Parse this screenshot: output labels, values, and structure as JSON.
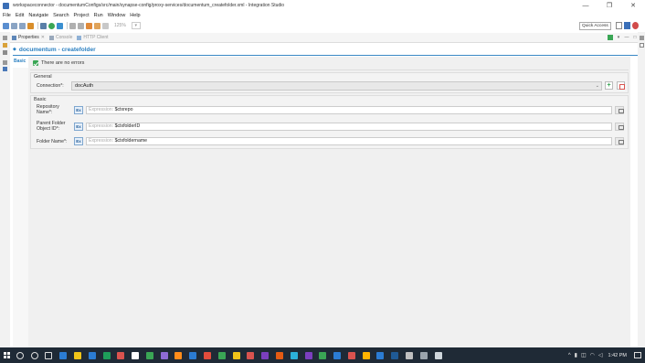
{
  "window": {
    "title": "workspaceconnector - documentumConfigs/src/main/synapse-config/proxy-services/documentum_createfolder.xml - Integration Studio",
    "controls": [
      "—",
      "❐",
      "✕"
    ]
  },
  "menu": [
    "File",
    "Edit",
    "Navigate",
    "Search",
    "Project",
    "Run",
    "Window",
    "Help"
  ],
  "toolbar": {
    "zoom": "125%",
    "quick_access": "Quick Access"
  },
  "views": {
    "tabs": [
      {
        "label": "Properties",
        "close": "✕",
        "active": true
      },
      {
        "label": "Console",
        "active": false
      },
      {
        "label": "HTTP Client",
        "active": false
      }
    ]
  },
  "properties": {
    "title": "documentum - createfolder",
    "side_tab": "Basic",
    "status": "There are no errors",
    "general": {
      "label": "General",
      "connection_label": "Connection*:",
      "connection_value": "docAuth"
    },
    "basic": {
      "label": "Basic",
      "fields": [
        {
          "label_line1": "Repository",
          "label_line2": "Name*:",
          "prefix": "Expression:",
          "value": "$ctxrepo"
        },
        {
          "label_line1": "Parent Folder",
          "label_line2": "Object ID*:",
          "prefix": "Expression:",
          "value": "$ctxfolderID"
        },
        {
          "label_line1": "Folder Name*:",
          "label_line2": "",
          "prefix": "Expression:",
          "value": "$ctxfoldername"
        }
      ],
      "expr_button": "Ex"
    }
  },
  "taskbar": {
    "clock": "1:42 PM",
    "apps": [
      "#2b7cd3",
      "#f0c419",
      "#2b7cd3",
      "#1e9e5a",
      "#d9534f",
      "#ffffff",
      "#3aa655",
      "#8e6bd6",
      "#ff8c1a",
      "#2b7cd3",
      "#e24c3c",
      "#3aa655",
      "#f0c419",
      "#d9534f",
      "#7b3fbf",
      "#e55b13",
      "#2bb0d9",
      "#7b3fbf",
      "#3aa655",
      "#2b7cd3",
      "#d9534f",
      "#ffb400",
      "#2b7cd3",
      "#1f5a96",
      "#c0c0c0",
      "#9aa4ad",
      "#cfd6dc"
    ]
  }
}
